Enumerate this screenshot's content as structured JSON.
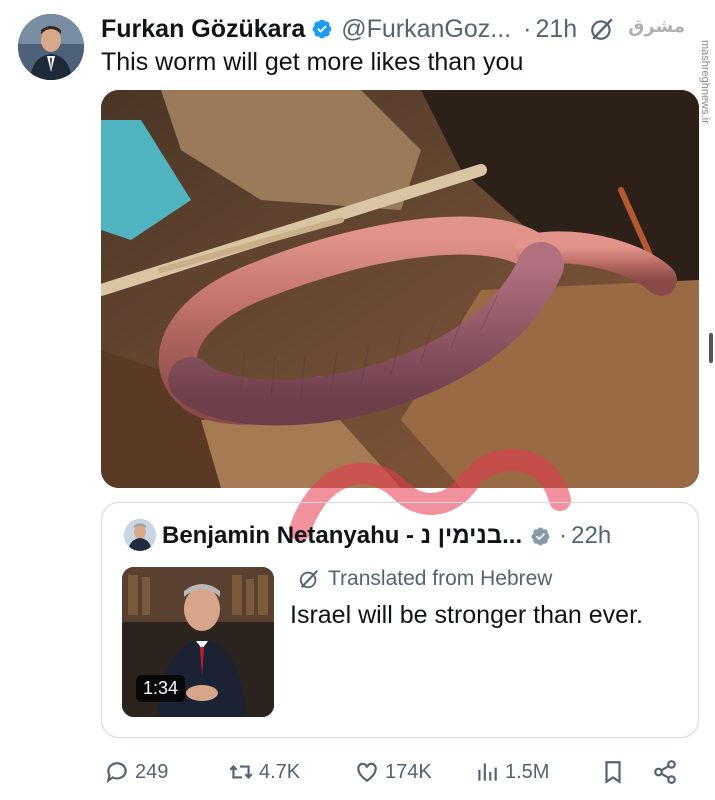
{
  "tweet": {
    "author_name": "Furkan Gözükara",
    "handle": "@FurkanGoz...",
    "separator": "·",
    "time": "21h",
    "text": "This worm will get more likes than you"
  },
  "watermark": {
    "persian": "مشرق",
    "site": "mashreghnews.ir"
  },
  "quote": {
    "author_name": "Benjamin Netanyahu - בנימין נ...",
    "separator": "·",
    "time": "22h",
    "translated_label": "Translated from Hebrew",
    "text": "Israel will be stronger than ever.",
    "video_duration": "1:34"
  },
  "actions": {
    "replies": "249",
    "reposts": "4.7K",
    "likes": "174K",
    "views": "1.5M"
  },
  "icons": {
    "verified": "verified-badge-icon",
    "grok": "grok-icon",
    "reply": "reply-icon",
    "repost": "repost-icon",
    "like": "like-icon",
    "views": "views-icon",
    "bookmark": "bookmark-icon",
    "share": "share-icon"
  },
  "colors": {
    "text": "#0f1419",
    "secondary": "#536471",
    "verified": "#1d9bf0",
    "border": "#cfd9de",
    "watermark": "#e8384f"
  }
}
